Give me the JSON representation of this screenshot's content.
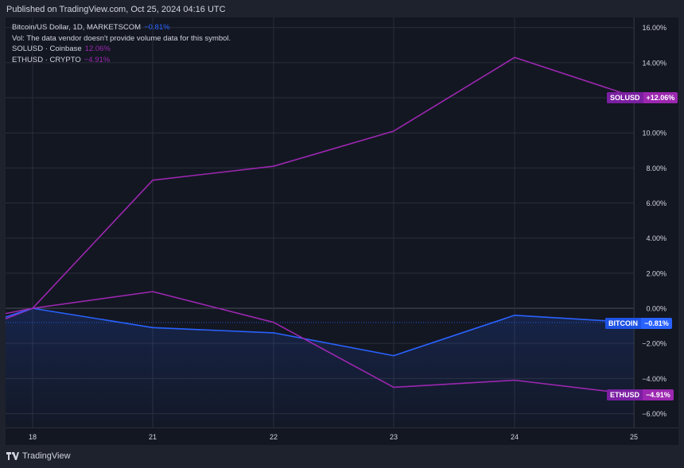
{
  "published": "Published on TradingView.com, Oct 25, 2024 04:16 UTC",
  "legend": {
    "main_symbol": "Bitcoin/US Dollar, 1D, MARKETSCOM",
    "main_change": "−0.81%",
    "volume_note": "Vol: The data vendor doesn't provide volume data for this symbol.",
    "sol_label": "SOLUSD · Coinbase",
    "sol_change": "12.06%",
    "eth_label": "ETHUSD · CRYPTO",
    "eth_change": "−4.91%"
  },
  "badges": {
    "sol": {
      "name": "SOLUSD",
      "value": "+12.06%"
    },
    "btc": {
      "name": "BITCOIN",
      "value": "−0.81%"
    },
    "eth": {
      "name": "ETHUSD",
      "value": "−4.91%"
    }
  },
  "footer": {
    "brand": "TradingView"
  },
  "colors": {
    "background": "#131722",
    "bitcoin": "#2962ff",
    "solusd": "#9c27b0",
    "ethusd": "#9c27b0",
    "grid": "#2a2e39",
    "axis_text": "#d1d4dc"
  },
  "chart_data": {
    "type": "line",
    "x_ticks": [
      "18",
      "21",
      "22",
      "23",
      "24",
      "25"
    ],
    "y_ticks": [
      "16.00%",
      "14.00%",
      "12.00%",
      "10.00%",
      "8.00%",
      "6.00%",
      "4.00%",
      "2.00%",
      "0.00%",
      "−2.00%",
      "−4.00%",
      "−6.00%"
    ],
    "y_tick_values": [
      16,
      14,
      12,
      10,
      8,
      6,
      4,
      2,
      0,
      -2,
      -4,
      -6
    ],
    "ylim": [
      -6.5,
      16.5
    ],
    "grid": true,
    "series": [
      {
        "name": "SOLUSD",
        "x": [
          "17",
          "18",
          "21",
          "22",
          "23",
          "24",
          "25"
        ],
        "values": [
          -0.6,
          0.0,
          7.3,
          8.1,
          10.1,
          14.3,
          12.06
        ]
      },
      {
        "name": "BITCOIN",
        "x": [
          "17",
          "18",
          "21",
          "22",
          "23",
          "24",
          "25"
        ],
        "values": [
          -0.5,
          0.0,
          -1.1,
          -1.4,
          -2.7,
          -0.4,
          -0.81
        ]
      },
      {
        "name": "ETHUSD",
        "x": [
          "17",
          "18",
          "21",
          "22",
          "23",
          "24",
          "25"
        ],
        "values": [
          -0.3,
          0.0,
          0.95,
          -0.8,
          -4.5,
          -4.1,
          -4.91
        ]
      }
    ]
  }
}
